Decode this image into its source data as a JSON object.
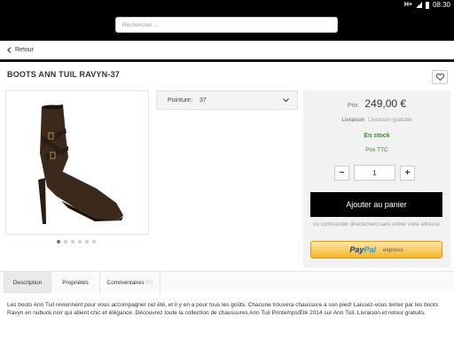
{
  "status_bar": {
    "signal": "H+",
    "time": "08:30"
  },
  "search": {
    "placeholder": "Rechercher ..."
  },
  "nav": {
    "back_label": "Retour"
  },
  "product": {
    "title": "BOOTS ANN TUIL RAVYN-37",
    "carousel": {
      "count": 6,
      "active": 1
    }
  },
  "size": {
    "label": "Pointure:",
    "value": "37"
  },
  "purchase": {
    "price_label": "Prix",
    "price": "249,00 €",
    "delivery_label": "Livraison",
    "delivery_value": "Livraison gratuite",
    "stock": "En stock",
    "tax_note": "Prix TTC",
    "quantity": "1",
    "minus": "−",
    "plus": "+",
    "add_to_cart": "Ajouter au panier",
    "or_direct": "ou commander directement sans entrer votre adresse",
    "paypal_pay": "Pay",
    "paypal_pal": "Pal",
    "paypal_express": "express"
  },
  "tabs": [
    {
      "label": "Description",
      "active": true
    },
    {
      "label": "Propriétés",
      "active": false
    },
    {
      "label": "Commentaires",
      "count": "(0)",
      "active": false
    }
  ],
  "description": "Les boots Ann Tuil reviennent pour vous accompagner cet été, et il y en a pour tous les goûts. Chacune trouvera chaussure à son pied! Laissez-vous tenter par les boots Ravyn en nubuck noir qui allient chic et élégance. Découvrez toute la collection de chaussures Ann Tuil Printemps/Eté 2014 sur Ann Tuil. Livraison et retour gratuits.",
  "colors": {
    "header": "#000000",
    "in_stock": "#3a8a2a",
    "cart_button": "#000000",
    "paypal_bg": "#f6b42a"
  },
  "icons": [
    "wifi-icon",
    "signal-icon",
    "battery-icon",
    "chevron-left-icon",
    "heart-icon",
    "chevron-down-icon"
  ]
}
